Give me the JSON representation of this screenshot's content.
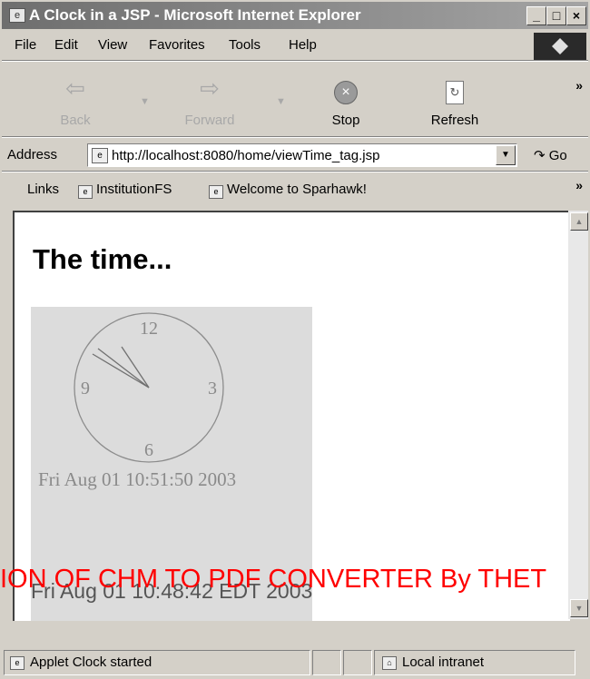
{
  "window": {
    "title": "A Clock in a JSP - Microsoft Internet Explorer",
    "minimize_glyph": "_",
    "maximize_glyph": "□",
    "close_glyph": "×"
  },
  "menu": {
    "items": [
      "File",
      "Edit",
      "View",
      "Favorites",
      "Tools",
      "Help"
    ]
  },
  "toolbar": {
    "back_label": "Back",
    "forward_label": "Forward",
    "stop_label": "Stop",
    "refresh_label": "Refresh",
    "back_icon": "left-arrow-icon",
    "forward_icon": "right-arrow-icon",
    "stop_icon": "stop-icon",
    "refresh_icon": "refresh-icon",
    "more_glyph": "»"
  },
  "address": {
    "label": "Address",
    "url": "http://localhost:8080/home/viewTime_tag.jsp",
    "go_label": "Go"
  },
  "links": {
    "label": "Links",
    "items": [
      "InstitutionFS",
      "Welcome to Sparhawk!"
    ],
    "more_glyph": "»"
  },
  "page": {
    "heading": "The time...",
    "applet": {
      "numerals": [
        "12",
        "3",
        "6",
        "9"
      ],
      "date_text": "Fri Aug 01 10:51:50 2003"
    },
    "server_time": "Fri Aug 01 10:48:42 EDT 2003"
  },
  "watermark": "ION OF CHM TO PDF CONVERTER By THET",
  "status": {
    "text": "Applet Clock started",
    "zone": "Local intranet"
  },
  "colors": {
    "watermark": "#ff0000",
    "applet_bg": "#dcdcdc",
    "chrome": "#d4d0c8"
  }
}
